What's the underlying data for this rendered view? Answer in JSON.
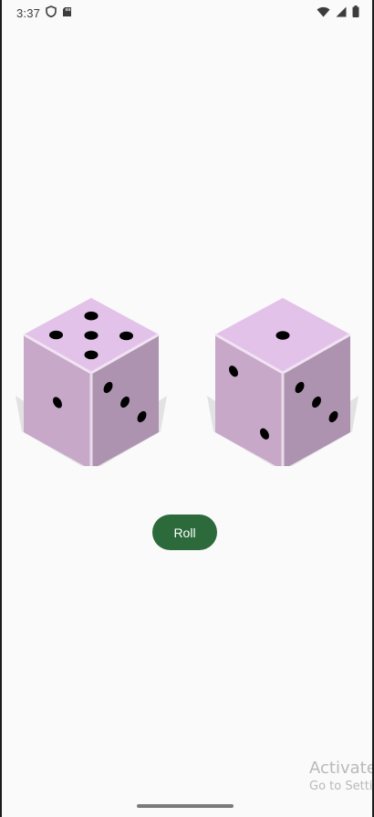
{
  "status_bar": {
    "time": "3:37",
    "left_icons": [
      "shield-icon",
      "sd-card-icon"
    ],
    "right_icons": [
      "wifi-icon",
      "signal-icon",
      "battery-icon"
    ]
  },
  "dice": [
    {
      "top_face_pips": 5,
      "front_face_pips": 1,
      "right_face_pips": 3
    },
    {
      "top_face_pips": 1,
      "front_face_pips": 2,
      "right_face_pips": 3
    }
  ],
  "roll_button": {
    "label": "Roll"
  },
  "watermark": {
    "title": "Activate",
    "subtitle": "Go to Setti"
  },
  "colors": {
    "background": "#fafafa",
    "die_top": "#e3c2ea",
    "die_front": "#c7a8c8",
    "die_side": "#ad93af",
    "pip": "#000000",
    "button": "#2c6a3b",
    "button_text": "#ffffff"
  }
}
